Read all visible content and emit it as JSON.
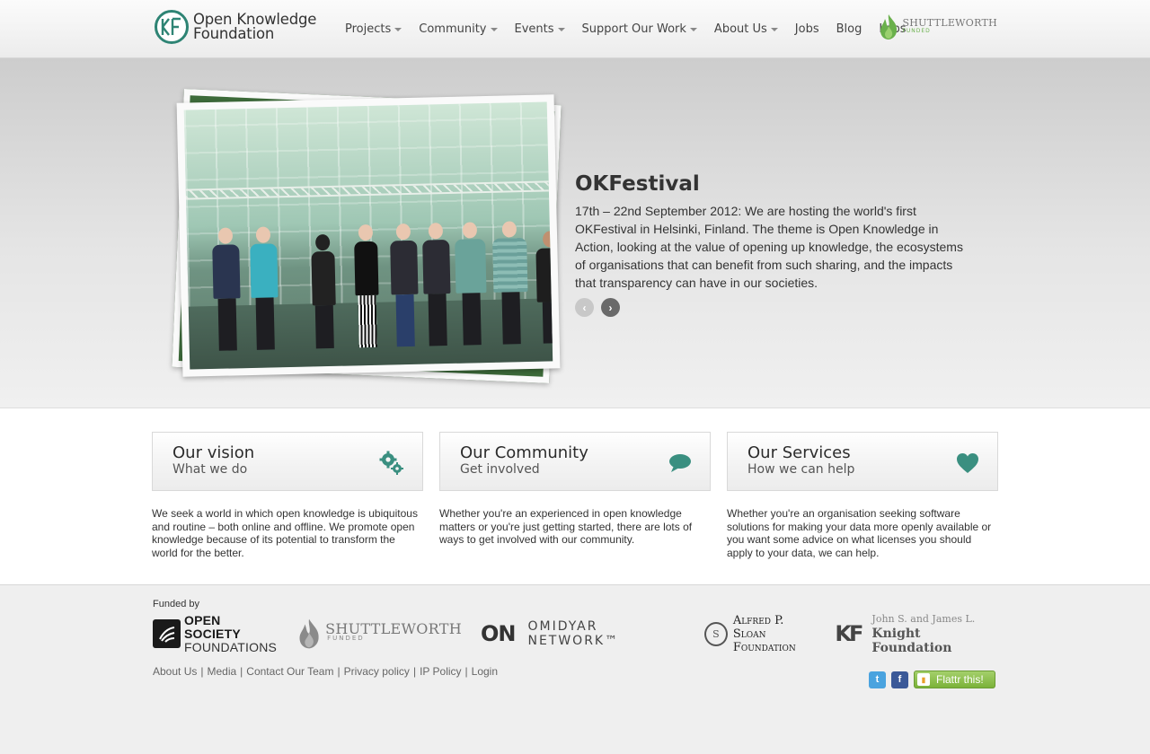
{
  "header": {
    "logo_line1": "Open Knowledge",
    "logo_line2": "Foundation",
    "nav": [
      {
        "label": "Projects",
        "dropdown": true
      },
      {
        "label": "Community",
        "dropdown": true
      },
      {
        "label": "Events",
        "dropdown": true
      },
      {
        "label": "Support Our Work",
        "dropdown": true
      },
      {
        "label": "About Us",
        "dropdown": true
      },
      {
        "label": "Jobs",
        "dropdown": false
      },
      {
        "label": "Blog",
        "dropdown": false
      },
      {
        "label": "Labs",
        "dropdown": false
      }
    ],
    "badge_main": "SHUTTLEWORTH",
    "badge_sub": "FUNDED"
  },
  "hero": {
    "title": "OKFestival",
    "body": "17th – 22nd September 2012: We are hosting the world's first OKFestival in Helsinki, Finland. The theme is Open Knowledge in Action, looking at the value of opening up knowledge, the ecosystems of organisations that can benefit from such sharing, and the impacts that transparency can have in our societies.",
    "prev_icon": "‹",
    "next_icon": "›"
  },
  "boxes": [
    {
      "title": "Our vision",
      "subtitle": "What we do",
      "icon": "gears-icon",
      "text": "We seek a world in which open knowledge is ubiquitous and routine – both online and offline. We promote open knowledge because of its potential to transform the world for the better."
    },
    {
      "title": "Our Community",
      "subtitle": "Get involved",
      "icon": "speech-bubble-icon",
      "text": "Whether you're an experienced in open knowledge matters or you're just getting started, there are lots of ways to get involved with our community."
    },
    {
      "title": "Our Services",
      "subtitle": "How we can help",
      "icon": "heart-icon",
      "text": "Whether you're an organisation seeking software solutions for making your data more openly available or you want some advice on what licenses you should apply to your data, we can help."
    }
  ],
  "footer": {
    "funded_by": "Funded by",
    "funders": {
      "osf_line1": "OPEN SOCIETY",
      "osf_line2": "FOUNDATIONS",
      "shuttleworth_main": "SHUTTLEWORTH",
      "shuttleworth_sub": "FUNDED",
      "omidyar_mark": "ON",
      "omidyar_text": "OMIDYAR NETWORK™",
      "sloan_line1": "Alfred P. Sloan",
      "sloan_line2": "Foundation",
      "knight_mark": "KF",
      "knight_line1": "John S. and James L.",
      "knight_line2": "Knight Foundation"
    },
    "links": [
      "About Us",
      "Media",
      "Contact Our Team",
      "Privacy policy",
      "IP Policy",
      "Login"
    ],
    "twitter_glyph": "t",
    "facebook_glyph": "f",
    "flattr_label": "Flattr this!"
  },
  "colors": {
    "accent": "#2e8474",
    "teal_icon": "#3a8f80",
    "flattr_green": "#7bb239"
  }
}
